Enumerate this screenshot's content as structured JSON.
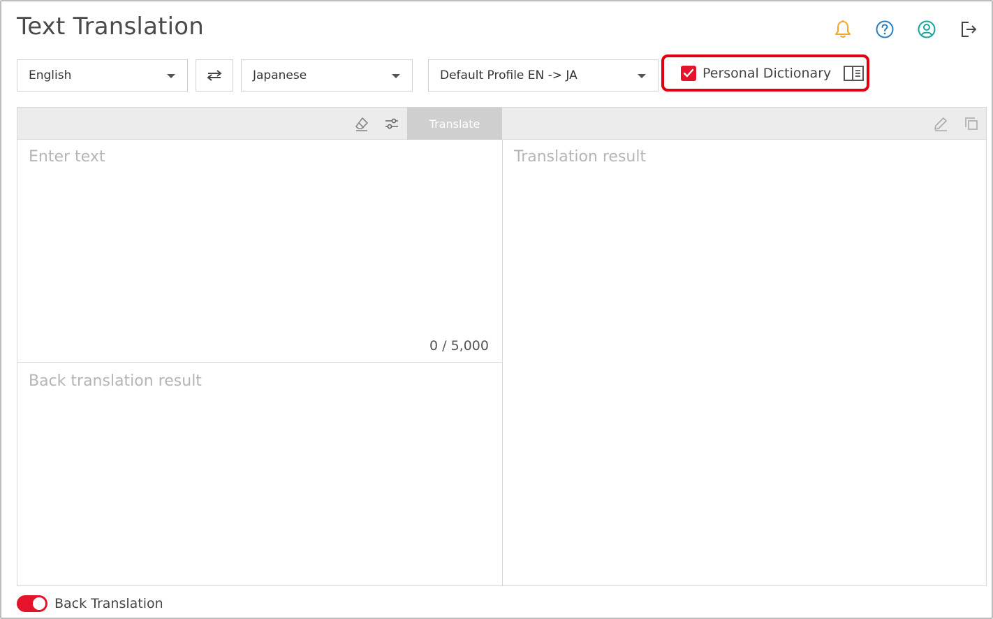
{
  "header": {
    "title": "Text Translation",
    "icons": [
      "bell-icon",
      "help-icon",
      "account-icon",
      "logout-icon"
    ]
  },
  "controls": {
    "source_language": "English",
    "target_language": "Japanese",
    "profile": "Default Profile EN -> JA",
    "personal_dictionary_label": "Personal Dictionary",
    "personal_dictionary_checked": true
  },
  "editor": {
    "translate_label": "Translate",
    "input_placeholder": "Enter text",
    "counter": "0 / 5,000",
    "back_translation_placeholder": "Back translation result",
    "result_placeholder": "Translation result"
  },
  "footer": {
    "back_translation_label": "Back Translation",
    "back_translation_on": true
  },
  "colors": {
    "accent": "#e3142b",
    "highlight_border": "#e00012",
    "bell": "#f5a623",
    "help": "#2a7fbf",
    "account": "#1aa39a"
  }
}
